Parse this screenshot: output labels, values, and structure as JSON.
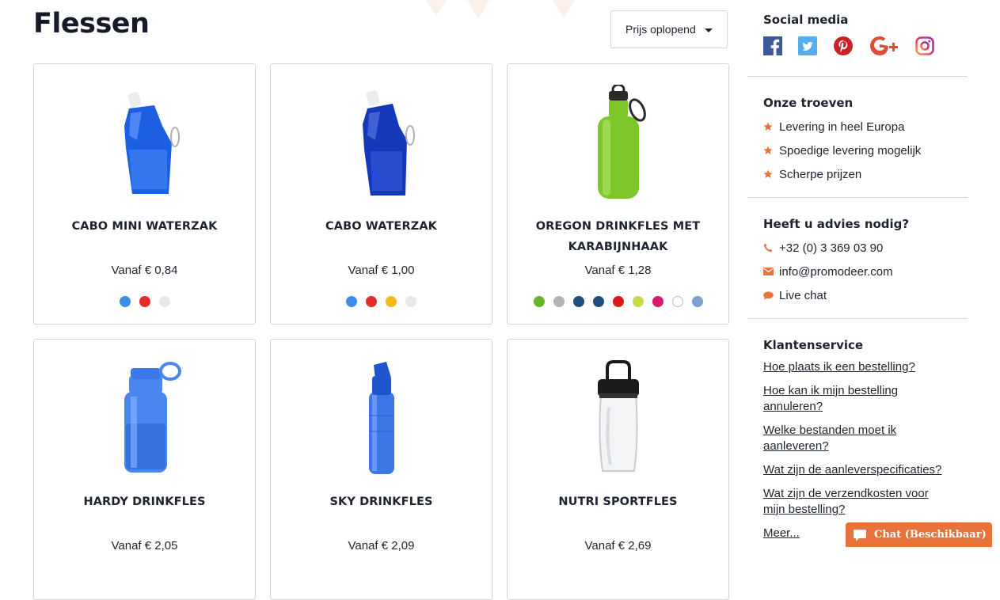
{
  "page": {
    "title": "Flessen"
  },
  "sort": {
    "label": "Prijs oplopend"
  },
  "products": [
    {
      "name": "CABO MINI WATERZAK",
      "price": "Vanaf € 0,84",
      "image": "blue-foldable-water-pouch",
      "colors": [
        "#3a8ee6",
        "#e32c2c",
        "#e8e8e8"
      ]
    },
    {
      "name": "CABO WATERZAK",
      "price": "Vanaf € 1,00",
      "image": "dark-blue-foldable-water-pouch",
      "colors": [
        "#3a8ee6",
        "#e32c2c",
        "#f7b91a",
        "#e8e8e8"
      ]
    },
    {
      "name": "OREGON DRINKFLES MET KARABIJNHAAK",
      "price": "Vanaf € 1,28",
      "image": "green-aluminium-bottle-with-carabiner",
      "colors": [
        "#63b52a",
        "#b3b3b3",
        "#1d4f7a",
        "#1d4f7a",
        "#e01818",
        "#c8d94e",
        "#d21c6e",
        "#ffffff",
        "#7da0cf"
      ]
    },
    {
      "name": "HARDY DRINKFLES",
      "price": "Vanaf € 2,05",
      "image": "blue-tritan-bottle",
      "colors": []
    },
    {
      "name": "SKY DRINKFLES",
      "price": "Vanaf € 2,09",
      "image": "blue-glass-bottle",
      "colors": []
    },
    {
      "name": "NUTRI SPORTFLES",
      "price": "Vanaf € 2,69",
      "image": "clear-sport-bottle-black-lid",
      "colors": []
    }
  ],
  "sidebar": {
    "social": {
      "title": "Social media",
      "icons": [
        "facebook-icon",
        "twitter-icon",
        "pinterest-icon",
        "google-plus-icon",
        "instagram-icon"
      ]
    },
    "troeven": {
      "title": "Onze troeven",
      "items": [
        "Levering in heel Europa",
        "Spoedige levering mogelijk",
        "Scherpe prijzen"
      ]
    },
    "advies": {
      "title": "Heeft u advies nodig?",
      "phone": "+32 (0) 3 369 03 90",
      "email": "info@promodeer.com",
      "chat": "Live chat"
    },
    "klantenservice": {
      "title": "Klantenservice",
      "links": [
        "Hoe plaats ik een bestelling?",
        "Hoe kan ik mijn bestelling annuleren?",
        "Welke bestanden moet ik aanleveren?",
        "Wat zijn de aanleverspecificaties?",
        "Wat zijn de verzendkosten voor mijn bestelling?",
        "Meer..."
      ]
    }
  },
  "chat_widget": {
    "label": "Chat (Beschikbaar)"
  },
  "colors": {
    "accent": "#e8733a",
    "text": "#1e2330",
    "border": "#d6d6d6"
  }
}
